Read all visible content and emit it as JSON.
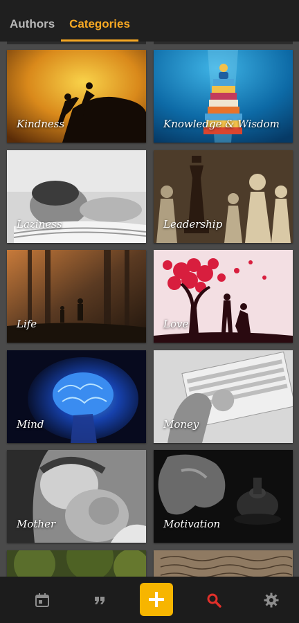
{
  "tabs": [
    {
      "label": "Authors",
      "active": false
    },
    {
      "label": "Categories",
      "active": true
    }
  ],
  "accent_color": "#f7a823",
  "categories": [
    {
      "label": "Kindness",
      "image": "silhouette-climbers-sunset"
    },
    {
      "label": "Knowledge & Wisdom",
      "image": "books-stack-reader"
    },
    {
      "label": "Laziness",
      "image": "sleeping-on-book"
    },
    {
      "label": "Leadership",
      "image": "chess-pieces"
    },
    {
      "label": "Life",
      "image": "foggy-forest-walkers"
    },
    {
      "label": "Love",
      "image": "heart-tree-couple"
    },
    {
      "label": "Mind",
      "image": "glowing-brain"
    },
    {
      "label": "Money",
      "image": "banknotes-hand"
    },
    {
      "label": "Mother",
      "image": "mother-kissing-baby"
    },
    {
      "label": "Motivation",
      "image": "muscle-arm-kettlebell"
    },
    {
      "label": "",
      "image": "forest-partial"
    },
    {
      "label": "",
      "image": "manuscript-partial"
    }
  ],
  "bottom_nav": [
    {
      "icon": "calendar-icon"
    },
    {
      "icon": "quote-icon"
    },
    {
      "icon": "plus-icon"
    },
    {
      "icon": "search-icon",
      "active": true,
      "color": "#e0302a"
    },
    {
      "icon": "gear-icon"
    }
  ]
}
